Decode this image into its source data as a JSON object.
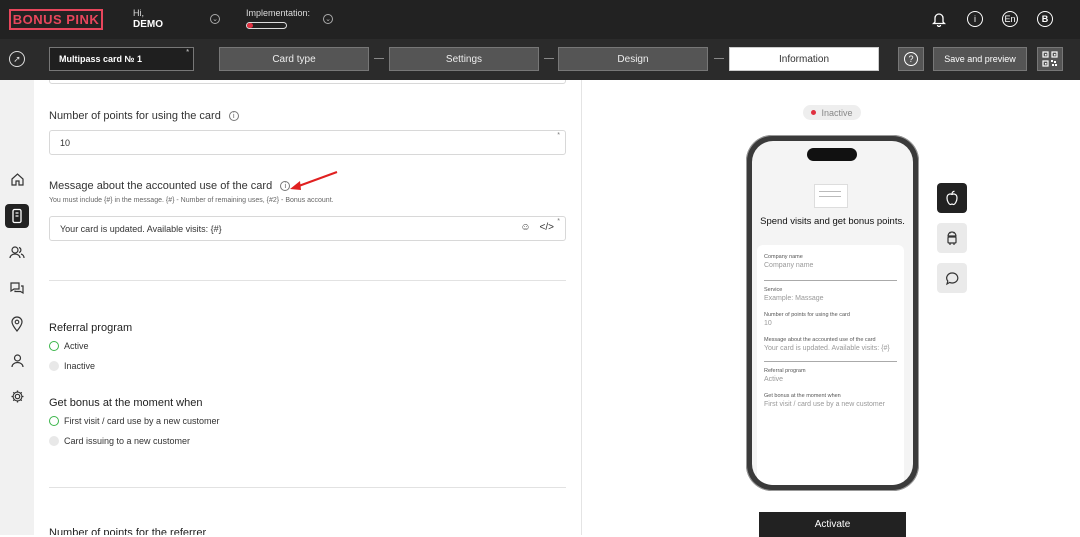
{
  "brand": {
    "logo": "BONUS PINK",
    "accent": "#e8465c"
  },
  "user": {
    "greeting": "Hi,",
    "name": "DEMO"
  },
  "implementation": {
    "label": "Implementation:",
    "progress": 0.15
  },
  "header": {
    "language": "En",
    "avatar_letter": "B"
  },
  "toolbar": {
    "card_name": "Multipass card № 1",
    "steps": [
      "Card type",
      "Settings",
      "Design",
      "Information"
    ],
    "active_step": "Information",
    "save_label": "Save and preview"
  },
  "form": {
    "points_label": "Number of points for using the card",
    "points_value": "10",
    "message_label": "Message about the accounted use of the card",
    "message_hint": "You must include {#} in the message. {#} - Number of remaining uses, {#2} - Bonus account.",
    "message_value": "Your card is updated. Available visits: {#}",
    "referral_title": "Referral program",
    "referral_options": [
      "Active",
      "Inactive"
    ],
    "bonus_title": "Get bonus at the moment when",
    "bonus_options": [
      "First visit / card use by a new customer",
      "Card issuing to a new customer"
    ],
    "referrer_title": "Number of points for the referrer"
  },
  "preview": {
    "status": "Inactive",
    "title": "Spend visits and get bonus points.",
    "company_label": "Company name",
    "company_value": "Company name",
    "service_label": "Service",
    "service_value": "Example: Massage",
    "points_label": "Number of points for using the card",
    "points_value": "10",
    "message_label": "Message about the accounted use of the card",
    "message_value": "Your card is updated. Available visits: {#}",
    "referral_label": "Referral program",
    "referral_value": "Active",
    "bonus_label": "Get bonus at the moment when",
    "bonus_value": "First visit / card use by a new customer",
    "activate_label": "Activate"
  }
}
